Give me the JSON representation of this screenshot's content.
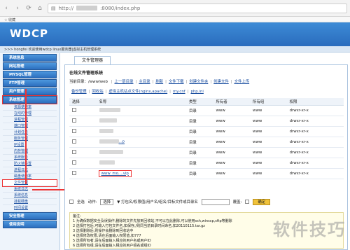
{
  "browser": {
    "url": "http://",
    "url_suffix": ":8080/index.php",
    "bookmark": "收藏"
  },
  "header": {
    "logo": "WDCP"
  },
  "statusbar": {
    "text": ">>> hongfei 欢迎使用wdcp linux服务器|虚拟主机管理系统"
  },
  "sidebar": {
    "items_top": [
      "系统信息",
      "网站管理",
      "MYSQL管理",
      "FTP管理",
      "用户管理"
    ],
    "active": "系统管理",
    "subitems": [
      "资源使用率",
      "在线的管理",
      "进程管理",
      "端口管理",
      "计划任务",
      "服务管理",
      "IP设置",
      "内存管理",
      "系统服务",
      "防火墙设置",
      "进程日志",
      "磁盘使用率"
    ],
    "highlight_sub": "文件管理",
    "subitems_after": [
      "系统日志",
      "系统信息",
      "挂载硬盘",
      "时间设置"
    ],
    "items_bottom": [
      "安全管理",
      "使用说明"
    ]
  },
  "main": {
    "tab": "文件管理器",
    "panel_title": "在线文件管理系统",
    "path_label": "当前目录：/www/web",
    "path_links": [
      "上一层目录",
      "主目录",
      "刷新",
      "文件下载",
      "创建文件夹",
      "创建文件",
      "文件上传"
    ],
    "links2": [
      "备份管理",
      "回收站",
      "虚拟主机站点文件(nginx,apache)",
      "my.cnf",
      "php.ini"
    ]
  },
  "table": {
    "headers": [
      "选择",
      "名称",
      "类型",
      "所有者",
      "所有组",
      "权限"
    ],
    "rows": [
      {
        "name": "",
        "type": "目录",
        "owner": "www",
        "group": "www",
        "perm": "drwxr-xr-x",
        "blur": 30
      },
      {
        "name": "",
        "type": "目录",
        "owner": "www",
        "group": "www",
        "perm": "drwxr-xr-x",
        "blur": 25
      },
      {
        "name": "",
        "type": "目录",
        "owner": "www",
        "group": "www",
        "perm": "drwxr-xr-x",
        "blur": 20
      },
      {
        "name": "...p",
        "type": "目录",
        "owner": "www",
        "group": "www",
        "perm": "drwxr-xr-x",
        "blur": 28
      },
      {
        "name": "",
        "type": "目录",
        "owner": "www",
        "group": "www",
        "perm": "drwxr-xr-x",
        "blur": 34
      },
      {
        "name": "",
        "type": "目录",
        "owner": "www",
        "group": "www",
        "perm": "drwxr-xr-x",
        "blur": 22
      },
      {
        "name": "www_mo....vip",
        "type": "目录",
        "owner": "www",
        "group": "www",
        "perm": "drwxr-xr-x",
        "blur": 0
      }
    ]
  },
  "actions": {
    "select_all": "全选",
    "action_label": "动作:",
    "action_value": "选择",
    "hint": "▼ 打包名/权限值/用户名/组名/目标文件或目录名",
    "override": "覆盖:",
    "submit": "确定"
  },
  "notes": {
    "title": "备注:",
    "lines": [
      "1 为确保数据安全及误操作,删除的文件先放到回收站,不可以在此删除,可以使用ssh,winscp,sftp等删除",
      "2 选择打包后,可输入打包文件名,如保存,/则同当前目录时间命名,如20110115.tar.gz",
      "3 选择删除后,则操作会删除到回收站中",
      "4 选择修改权限,请在后面输入权限值,如777",
      "5 选择所有者,请在后面输入相应的用户名或用户ID",
      "6 选择所有组,请在后面输入相应的用户组名或组ID"
    ]
  },
  "watermark": "软件技巧"
}
